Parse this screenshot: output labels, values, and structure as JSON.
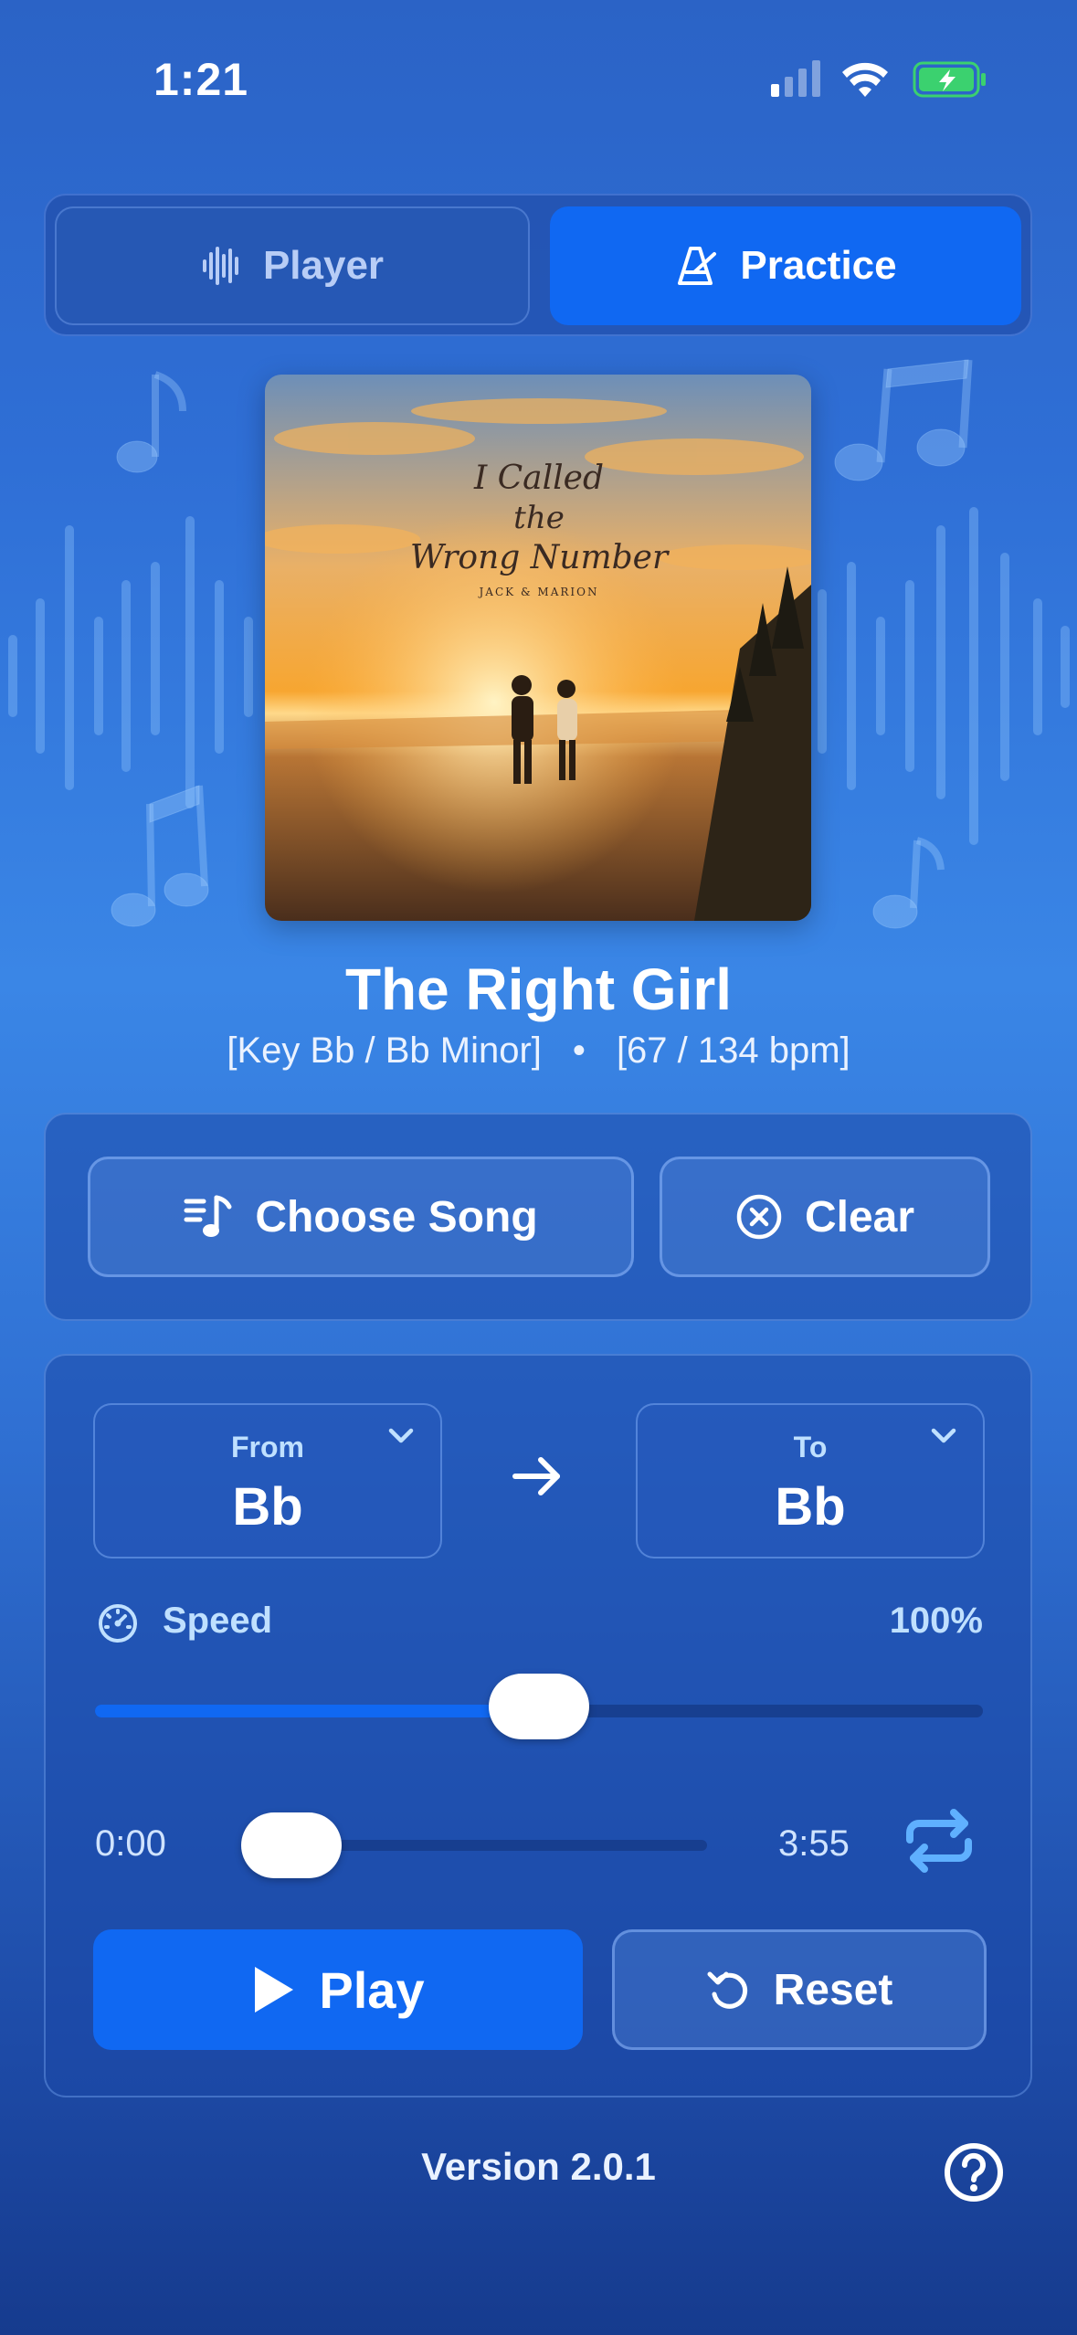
{
  "status_bar": {
    "time": "1:21",
    "icons": [
      "cellular-signal-icon",
      "wifi-icon",
      "battery-charging-icon"
    ]
  },
  "tabs": [
    {
      "label": "Player",
      "icon": "waveform-icon",
      "selected": false
    },
    {
      "label": "Practice",
      "icon": "metronome-icon",
      "selected": true
    }
  ],
  "album": {
    "title_line1": "I Called",
    "title_line2": "the",
    "title_line3": "Wrong Number",
    "artist": "JACK & MARION"
  },
  "song": {
    "title": "The Right Girl",
    "key_info": "[Key Bb / Bb Minor]",
    "separator": "•",
    "bpm_info": "[67 / 134 bpm]"
  },
  "song_actions": {
    "choose_label": "Choose Song",
    "clear_label": "Clear"
  },
  "transpose": {
    "from_label": "From",
    "from_value": "Bb",
    "to_label": "To",
    "to_value": "Bb"
  },
  "speed": {
    "label": "Speed",
    "value_text": "100%",
    "slider_fraction": 0.5
  },
  "playback": {
    "start_time": "0:00",
    "end_time": "3:55",
    "progress_fraction": 0.0
  },
  "controls": {
    "play_label": "Play",
    "reset_label": "Reset"
  },
  "footer": {
    "version": "Version 2.0.1"
  },
  "colors": {
    "accent": "#1068f2",
    "label_blue": "#bfe0ff"
  }
}
